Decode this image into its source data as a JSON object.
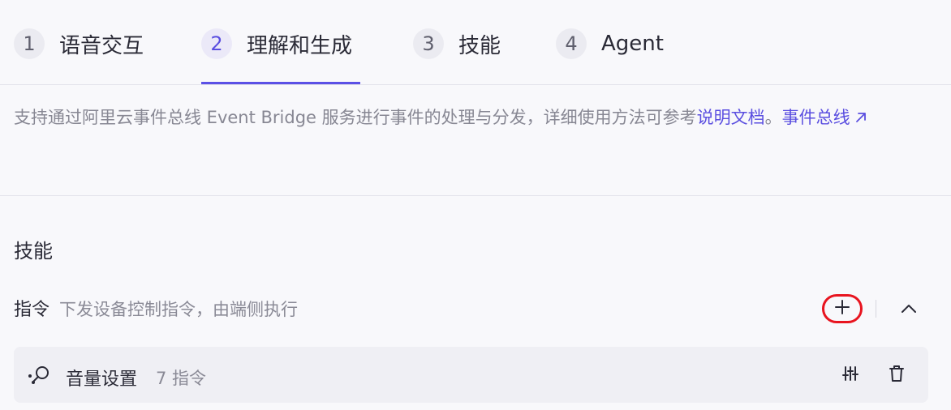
{
  "steps": [
    {
      "num": "1",
      "label": "语音交互",
      "active": false
    },
    {
      "num": "2",
      "label": "理解和生成",
      "active": true
    },
    {
      "num": "3",
      "label": "技能",
      "active": false
    },
    {
      "num": "4",
      "label": "Agent",
      "active": false
    }
  ],
  "description": {
    "text": "支持通过阿里云事件总线 Event Bridge 服务进行事件的处理与分发，详细使用方法可参考",
    "doc_link": "说明文档",
    "separator": "。",
    "bus_link": "事件总线"
  },
  "section_title": "技能",
  "command": {
    "title": "指令",
    "description": "下发设备控制指令，由端侧执行"
  },
  "skill": {
    "name": "音量设置",
    "count": "7 指令"
  },
  "colors": {
    "accent": "#5b50e6",
    "highlight_border": "#e8141f"
  },
  "icons": {
    "external_link": "external-link-icon",
    "add": "plus-icon",
    "collapse": "chevron-up-icon",
    "skill": "skill-node-icon",
    "settings": "sliders-icon",
    "delete": "trash-icon"
  }
}
